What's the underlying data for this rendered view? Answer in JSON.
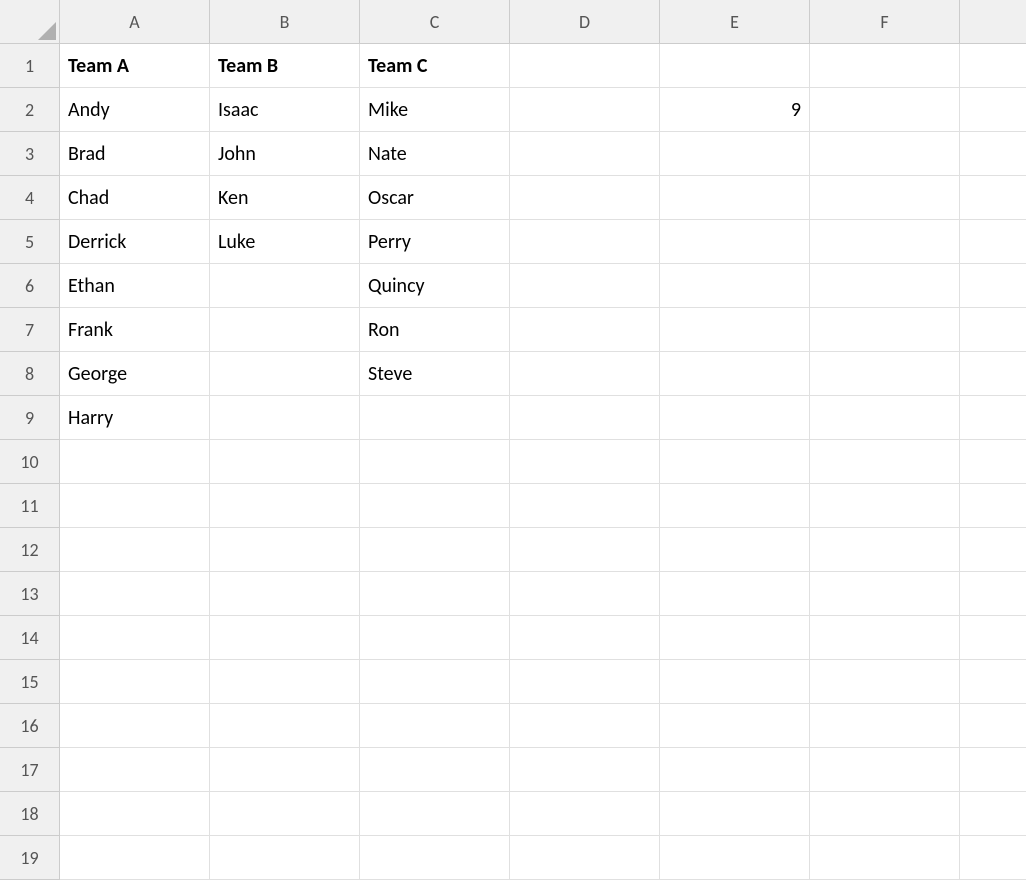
{
  "columns": [
    "A",
    "B",
    "C",
    "D",
    "E",
    "F"
  ],
  "rowCount": 19,
  "headers": {
    "A1": "Team A",
    "B1": "Team B",
    "C1": "Team C"
  },
  "cells": {
    "A2": "Andy",
    "A3": "Brad",
    "A4": "Chad",
    "A5": "Derrick",
    "A6": "Ethan",
    "A7": "Frank",
    "A8": "George",
    "A9": "Harry",
    "B2": "Isaac",
    "B3": "John",
    "B4": "Ken",
    "B5": "Luke",
    "C2": "Mike",
    "C3": "Nate",
    "C4": "Oscar",
    "C5": "Perry",
    "C6": "Quincy",
    "C7": "Ron",
    "C8": "Steve",
    "E2": "9"
  },
  "rightAlignCells": [
    "E2"
  ]
}
